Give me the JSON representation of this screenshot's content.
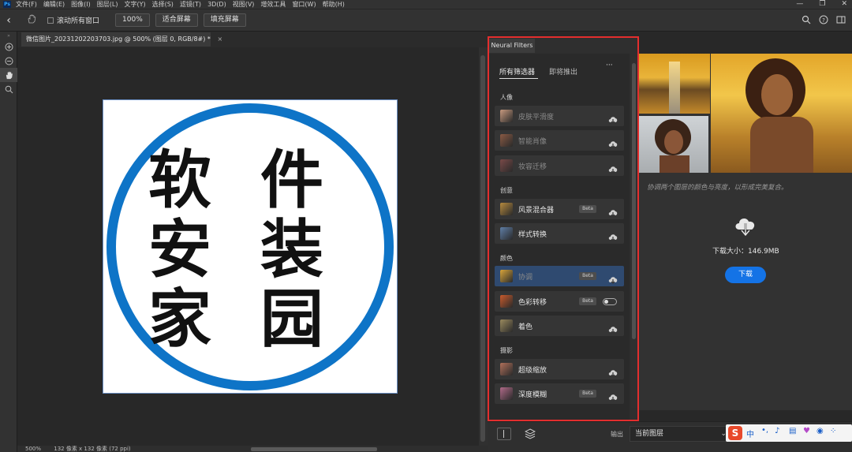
{
  "menu": {
    "logo": "Ps",
    "items": [
      "文件(F)",
      "编辑(E)",
      "图像(I)",
      "图层(L)",
      "文字(Y)",
      "选择(S)",
      "滤镜(T)",
      "3D(D)",
      "视图(V)",
      "增效工具",
      "窗口(W)",
      "帮助(H)"
    ],
    "window_controls": [
      "—",
      "❐",
      "✕"
    ]
  },
  "options": {
    "scroll_all_label": "滚动所有窗口",
    "zoom_100": "100%",
    "fit_screen": "适合屏幕",
    "fill_screen": "填充屏幕"
  },
  "document": {
    "tab_title": "微信图片_20231202203703.jpg @ 500% (图层 0, RGB/8#) *",
    "tab_close": "×",
    "status_zoom": "500%",
    "status_size": "132 像素 x 132 像素 (72 ppi)",
    "image_chars": [
      "软",
      "件",
      "安",
      "装",
      "家",
      "园"
    ]
  },
  "neural_filters": {
    "panel_title": "Neural Filters",
    "tabs": [
      "所有筛选器",
      "即将推出"
    ],
    "more": "···",
    "sections": [
      {
        "title": "人像",
        "filters": [
          {
            "label": "皮肤平滑度",
            "beta": false,
            "dim": true,
            "icon_color": "#c89a7f"
          },
          {
            "label": "智能肖像",
            "beta": false,
            "dim": true,
            "icon_color": "#8a5a44"
          },
          {
            "label": "妆容迁移",
            "beta": false,
            "dim": true,
            "icon_color": "#7a4a48"
          }
        ]
      },
      {
        "title": "创意",
        "filters": [
          {
            "label": "风景混合器",
            "beta": true,
            "dim": false,
            "icon_color": "#b68a3e"
          },
          {
            "label": "样式转换",
            "beta": false,
            "dim": false,
            "icon_color": "#5f7ea6"
          }
        ]
      },
      {
        "title": "颜色",
        "filters": [
          {
            "label": "协调",
            "beta": true,
            "dim": true,
            "selected": true,
            "icon_color": "#d9a53a"
          },
          {
            "label": "色彩转移",
            "beta": true,
            "dim": false,
            "toggle": true,
            "icon_color": "#c85a2c"
          },
          {
            "label": "着色",
            "beta": false,
            "dim": false,
            "icon_color": "#9a8a5e"
          }
        ]
      },
      {
        "title": "摄影",
        "filters": [
          {
            "label": "超级缩放",
            "beta": false,
            "dim": false,
            "icon_color": "#b0705a"
          },
          {
            "label": "深度模糊",
            "beta": true,
            "dim": false,
            "icon_color": "#b06a88"
          }
        ]
      }
    ],
    "beta_label": "Beta"
  },
  "preview": {
    "description": "协调两个图层的颜色与亮度，以形成完美复合。",
    "download_size": "下载大小：146.9MB",
    "download_button": "下载"
  },
  "bottom": {
    "output_label": "输出",
    "output_value": "当前图层"
  },
  "colors": {
    "accent": "#1473e6",
    "highlight_border": "#e32e2e",
    "ring": "#0e74c7"
  }
}
